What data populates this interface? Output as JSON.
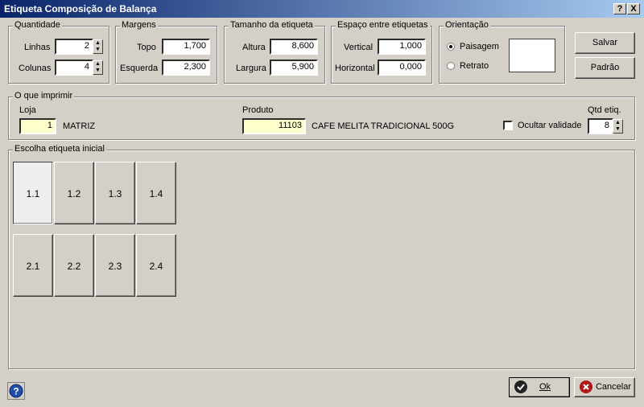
{
  "window": {
    "title": "Etiqueta Composição de Balança",
    "help_btn": "?",
    "close_btn": "X"
  },
  "quantidade": {
    "label": "Quantidade",
    "linhas_label": "Linhas",
    "linhas": "2",
    "colunas_label": "Colunas",
    "colunas": "4"
  },
  "margens": {
    "label": "Margens",
    "topo_label": "Topo",
    "topo": "1,700",
    "esquerda_label": "Esquerda",
    "esquerda": "2,300"
  },
  "tamanho": {
    "label": "Tamanho da etiqueta",
    "altura_label": "Altura",
    "altura": "8,600",
    "largura_label": "Largura",
    "largura": "5,900"
  },
  "espaco": {
    "label": "Espaço entre etiquetas",
    "vertical_label": "Vertical",
    "vertical": "1,000",
    "horizontal_label": "Horizontal",
    "horizontal": "0,000"
  },
  "orientacao": {
    "label": "Orientação",
    "paisagem": "Paisagem",
    "retrato": "Retrato",
    "selected": "Paisagem"
  },
  "buttons": {
    "salvar": "Salvar",
    "padrao": "Padrão",
    "ok": "Ok",
    "cancelar": "Cancelar"
  },
  "imprimir": {
    "label": "O que imprimir",
    "loja_label": "Loja",
    "loja": "1",
    "loja_nome": "MATRIZ",
    "produto_label": "Produto",
    "produto": "11103",
    "produto_nome": "CAFE MELITA TRADICIONAL 500G",
    "ocultar_validade": "Ocultar validade",
    "qtd_label": "Qtd etiq.",
    "qtd": "8"
  },
  "escolha": {
    "label": "Escolha etiqueta inicial",
    "row1": [
      "1.1",
      "1.2",
      "1.3",
      "1.4"
    ],
    "row2": [
      "2.1",
      "2.2",
      "2.3",
      "2.4"
    ],
    "selected": "1.1"
  },
  "icons": {
    "help": "help-icon",
    "ok": "check-icon",
    "cancel": "cancel-icon"
  },
  "colors": {
    "title_start": "#0a246a",
    "title_end": "#a6caf0",
    "input_highlight": "#ffffcc",
    "face": "#d4d0c8"
  }
}
